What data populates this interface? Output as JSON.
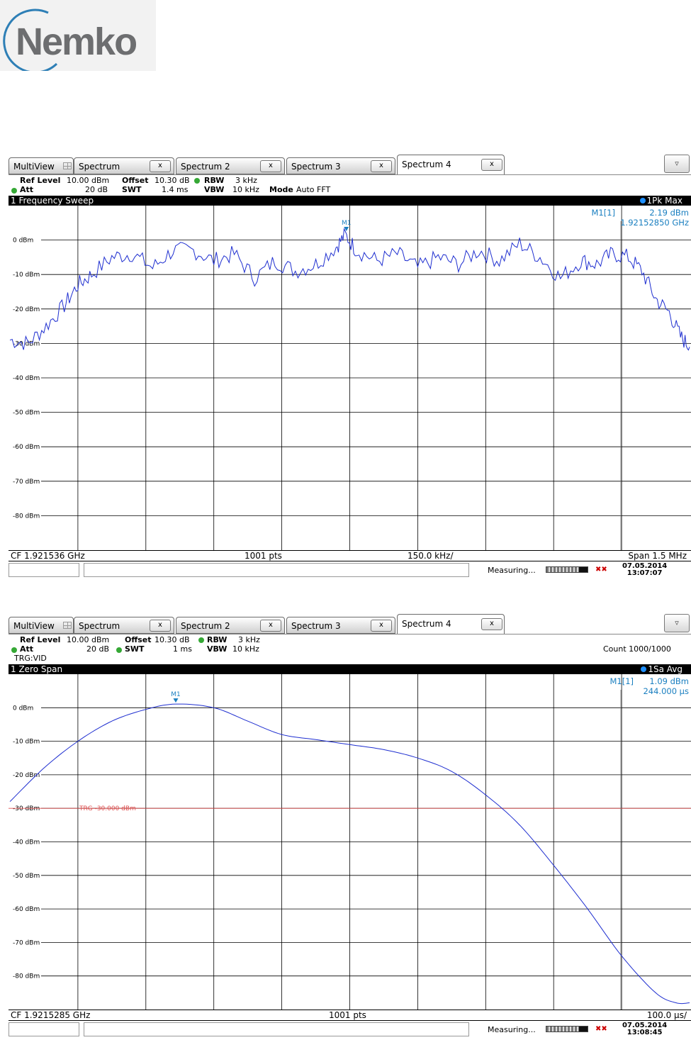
{
  "logo": {
    "text": "Nemko"
  },
  "tabs": [
    "MultiView",
    "Spectrum",
    "Spectrum 2",
    "Spectrum 3",
    "Spectrum 4"
  ],
  "tab_close": "x",
  "dropdown_glyph": "▿",
  "colors": {
    "trace": "#1f2fd0",
    "marker_text": "#1a7fc0",
    "trigger_line": "#e05050",
    "grid": "#000000",
    "led_green": "#35a835"
  },
  "panel1": {
    "settings": {
      "ref_level_label": "Ref Level",
      "ref_level": "10.00 dBm",
      "offset_label": "Offset",
      "offset": "10.30 dB",
      "rbw_label": "RBW",
      "rbw": "3 kHz",
      "att_label": "Att",
      "att": "20 dB",
      "swt_label": "SWT",
      "swt": "1.4 ms",
      "vbw_label": "VBW",
      "vbw": "10 kHz",
      "mode_label": "Mode",
      "mode": "Auto FFT"
    },
    "title": "1 Frequency Sweep",
    "trace_label": "1Pk Max",
    "marker": {
      "name": "M1",
      "readout_label": "M1[1]",
      "level": "2.19 dBm",
      "position": "1.92152850 GHz"
    },
    "footer": {
      "cf": "CF 1.921536 GHz",
      "pts": "1001 pts",
      "div": "150.0 kHz/",
      "span": "Span 1.5 MHz"
    },
    "status": {
      "measuring": "Measuring...",
      "date": "07.05.2014",
      "time": "13:07:07"
    }
  },
  "panel2": {
    "settings": {
      "ref_level_label": "Ref Level",
      "ref_level": "10.00 dBm",
      "offset_label": "Offset",
      "offset": "10.30 dB",
      "rbw_label": "RBW",
      "rbw": "3 kHz",
      "att_label": "Att",
      "att": "20 dB",
      "swt_label": "SWT",
      "swt": "1 ms",
      "vbw_label": "VBW",
      "vbw": "10 kHz",
      "trigger": "TRG:VID",
      "count": "Count 1000/1000"
    },
    "title": "1 Zero Span",
    "trace_label": "1Sa Avg",
    "marker": {
      "name": "M1",
      "readout_label": "M1[1]",
      "level": "1.09 dBm",
      "position": "244.000 µs"
    },
    "trigger_label": "TRG -30.000 dBm",
    "footer": {
      "cf": "CF 1.9215285 GHz",
      "pts": "1001 pts",
      "div": "100.0 µs/"
    },
    "status": {
      "measuring": "Measuring...",
      "date": "07.05.2014",
      "time": "13:08:45"
    }
  },
  "chart_data": [
    {
      "type": "line",
      "title": "1 Frequency Sweep",
      "x_unit": "GHz",
      "xlim": [
        1.920786,
        1.922286
      ],
      "ylim": [
        -90,
        10
      ],
      "y_tick_labels": [
        "0 dBm",
        "-10 dBm",
        "-20 dBm",
        "-30 dBm",
        "-40 dBm",
        "-50 dBm",
        "-60 dBm",
        "-70 dBm",
        "-80 dBm"
      ],
      "grid": true,
      "series": [
        {
          "name": "1Pk Max",
          "x": [
            1.920786,
            1.920826,
            1.920866,
            1.920906,
            1.920936,
            1.920966,
            1.921011,
            1.921056,
            1.921101,
            1.921146,
            1.921191,
            1.921236,
            1.921281,
            1.921326,
            1.921371,
            1.921416,
            1.921461,
            1.921506,
            1.921526,
            1.921551,
            1.921596,
            1.921641,
            1.921686,
            1.921731,
            1.921776,
            1.921821,
            1.921866,
            1.921911,
            1.921956,
            1.922001,
            1.922046,
            1.922081,
            1.922116,
            1.922151,
            1.922181,
            1.922211,
            1.922241,
            1.922266,
            1.922286
          ],
          "values": [
            -29,
            -30,
            -25,
            -19,
            -13,
            -10,
            -5,
            -4,
            -8,
            -3,
            -3,
            -6,
            -4,
            -11,
            -6,
            -9,
            -7,
            -2,
            1.5,
            -3,
            -6,
            -4,
            -8,
            -5,
            -7,
            -3,
            -6,
            -1,
            -5,
            -11,
            -6,
            -7,
            -4,
            -5,
            -9,
            -17,
            -21,
            -28,
            -31
          ]
        }
      ],
      "marker": {
        "name": "M1",
        "x": 1.9215285,
        "y": 2.19
      }
    },
    {
      "type": "line",
      "title": "1 Zero Span",
      "x_unit": "µs",
      "xlim": [
        0,
        1000
      ],
      "ylim": [
        -90,
        10
      ],
      "y_tick_labels": [
        "0 dBm",
        "-10 dBm",
        "-20 dBm",
        "-30 dBm",
        "-40 dBm",
        "-50 dBm",
        "-60 dBm",
        "-70 dBm",
        "-80 dBm"
      ],
      "grid": true,
      "trigger_level": -30,
      "series": [
        {
          "name": "1Sa Avg",
          "x": [
            0,
            50,
            100,
            150,
            200,
            244,
            300,
            350,
            400,
            450,
            500,
            550,
            600,
            650,
            700,
            750,
            800,
            850,
            900,
            950,
            980,
            1000
          ],
          "values": [
            -28,
            -18,
            -10,
            -4,
            -0.5,
            1.09,
            0,
            -4,
            -8,
            -9.5,
            -11,
            -12.5,
            -15,
            -19,
            -26,
            -35,
            -47,
            -60,
            -74,
            -85,
            -88,
            -88
          ]
        }
      ],
      "marker": {
        "name": "M1",
        "x": 244,
        "y": 1.09
      }
    }
  ]
}
